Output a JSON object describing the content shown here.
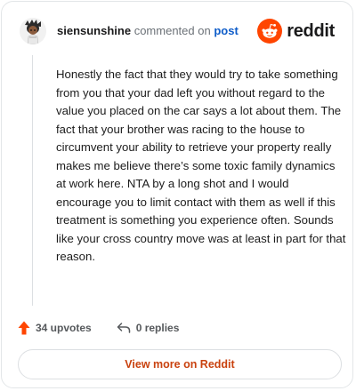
{
  "header": {
    "username": "siensunshine",
    "action_text": "commented on",
    "post_link": "post",
    "brand_word": "reddit"
  },
  "comment": {
    "body": "Honestly the fact that they would try to take something from you that your dad left you without regard to the value you placed on the car says a lot about them. The fact that your brother was racing to the house to circumvent your ability to retrieve your property really makes me believe there’s some toxic family dynamics at work here. NTA by a long shot and I would encourage you to limit contact with them as well if this treatment is something you experience often. Sounds like your cross country move was at least in part for that reason."
  },
  "actions": {
    "upvotes_label": "34 upvotes",
    "replies_label": "0 replies",
    "upvote_icon": "arrow-up-icon",
    "reply_icon": "reply-arrow-icon"
  },
  "footer": {
    "view_more_label": "View more on Reddit"
  },
  "colors": {
    "brand": "#ff4500",
    "link": "#0f5dc9",
    "view_more_text": "#c9420f",
    "upvote": "#ff4500"
  }
}
